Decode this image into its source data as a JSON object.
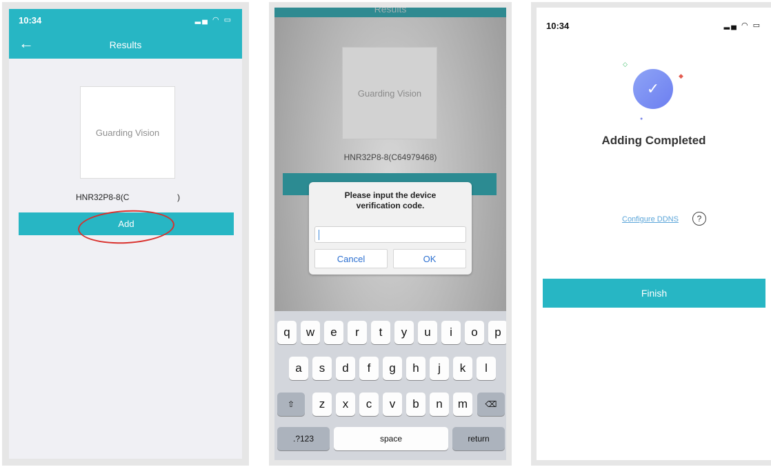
{
  "screen1": {
    "time": "10:34",
    "status_icons": "▂▄ ◠ ▭",
    "back_icon": "←",
    "title": "Results",
    "logo_text": "Guarding Vision",
    "device_name": "HNR32P8-8(C",
    "device_name_close": ")",
    "add_label": "Add"
  },
  "screen2": {
    "title": "Results",
    "logo_text": "Guarding Vision",
    "device_name": "HNR32P8-8(C64979468)",
    "dialog_message": "Please input the device verification code.",
    "input_value": "",
    "cancel_label": "Cancel",
    "ok_label": "OK",
    "keyboard": {
      "row1": [
        "q",
        "w",
        "e",
        "r",
        "t",
        "y",
        "u",
        "i",
        "o",
        "p"
      ],
      "row2": [
        "a",
        "s",
        "d",
        "f",
        "g",
        "h",
        "j",
        "k",
        "l"
      ],
      "row3": [
        "z",
        "x",
        "c",
        "v",
        "b",
        "n",
        "m"
      ],
      "shift": "⇧",
      "backspace": "⌫",
      "numbers": ".?123",
      "space": "space",
      "return": "return"
    }
  },
  "screen3": {
    "time": "10:34",
    "status_icons": "▂▄ ◠ ▭",
    "check_icon": "✓",
    "title": "Adding Completed",
    "configure_ddns": "Configure DDNS",
    "help_icon": "?",
    "finish_label": "Finish"
  },
  "colors": {
    "accent": "#27b6c4",
    "highlight_ring": "#d9302c",
    "link": "#5aa5d9",
    "check_gradient_start": "#8ea4f6",
    "check_gradient_end": "#6c7ef0"
  }
}
